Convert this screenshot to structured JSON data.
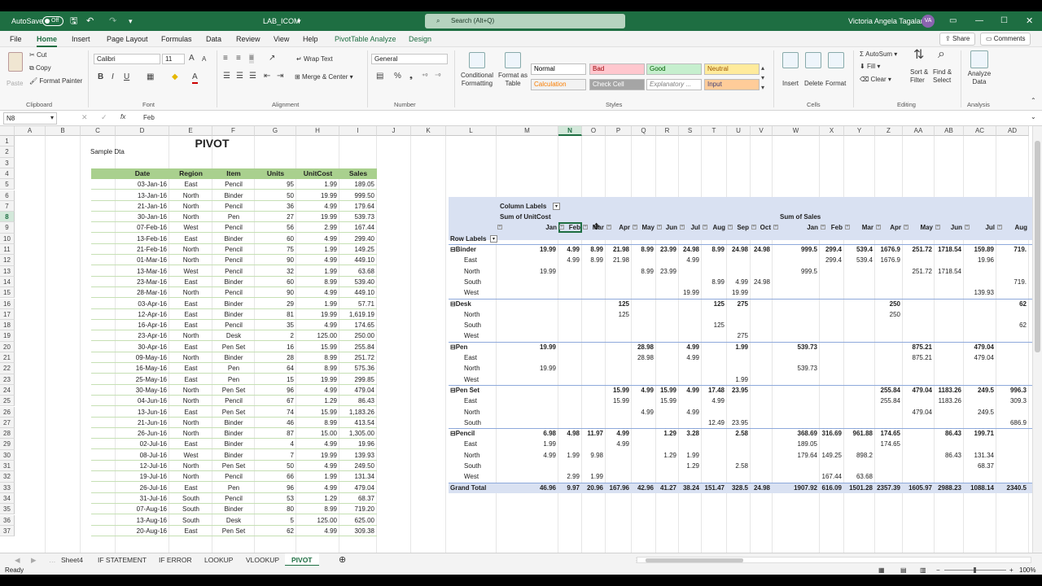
{
  "titlebar": {
    "autosave": "AutoSave",
    "toggle": "Off",
    "filename": "LAB_ICOM",
    "search": "Search (Alt+Q)",
    "user": "Victoria Angela Tagalan",
    "initials": "VA"
  },
  "menu": {
    "tabs": [
      "File",
      "Home",
      "Insert",
      "Page Layout",
      "Formulas",
      "Data",
      "Review",
      "View",
      "Help",
      "PivotTable Analyze",
      "Design"
    ],
    "share": "Share",
    "comments": "Comments"
  },
  "ribbon": {
    "paste": "Paste",
    "cut": "Cut",
    "copy": "Copy",
    "format_painter": "Format Painter",
    "clipboard": "Clipboard",
    "font_name": "Calibri",
    "font_size": "11",
    "font": "Font",
    "wrap_text": "Wrap Text",
    "merge": "Merge & Center",
    "alignment": "Alignment",
    "number_format": "General",
    "number": "Number",
    "cond_format": "Conditional Formatting",
    "format_table": "Format as Table",
    "styles": [
      {
        "label": "Normal",
        "bg": "#ffffff",
        "fg": "#000000"
      },
      {
        "label": "Bad",
        "bg": "#ffc7ce",
        "fg": "#9c0006"
      },
      {
        "label": "Good",
        "bg": "#c6efce",
        "fg": "#006100"
      },
      {
        "label": "Neutral",
        "bg": "#ffeb9c",
        "fg": "#9c5700"
      },
      {
        "label": "Calculation",
        "bg": "#f2f2f2",
        "fg": "#fa7d00"
      },
      {
        "label": "Check Cell",
        "bg": "#a5a5a5",
        "fg": "#ffffff"
      },
      {
        "label": "Explanatory ...",
        "bg": "#ffffff",
        "fg": "#7f7f7f"
      },
      {
        "label": "Input",
        "bg": "#ffcc99",
        "fg": "#3f3f76"
      }
    ],
    "styles_label": "Styles",
    "insert": "Insert",
    "delete": "Delete",
    "format": "Format",
    "cells": "Cells",
    "autosum": "AutoSum",
    "fill": "Fill",
    "clear": "Clear",
    "sort_filter": "Sort & Filter",
    "find_select": "Find & Select",
    "editing": "Editing",
    "analyze_data": "Analyze Data",
    "analysis": "Analysis"
  },
  "formula_bar": {
    "name_box": "N8",
    "fx": "fx",
    "content": "Feb"
  },
  "columns": [
    "A",
    "B",
    "C",
    "D",
    "E",
    "F",
    "G",
    "H",
    "I",
    "J",
    "K",
    "L",
    "M",
    "N",
    "O",
    "P",
    "Q",
    "R",
    "S",
    "T",
    "U",
    "V",
    "W",
    "X",
    "Y",
    "Z",
    "AA",
    "AB",
    "AC",
    "AD"
  ],
  "rows": [
    "1",
    "2",
    "3",
    "4",
    "5",
    "6",
    "7",
    "8",
    "9",
    "10",
    "11",
    "12",
    "13",
    "14",
    "15",
    "16",
    "17",
    "18",
    "19",
    "20",
    "21",
    "22",
    "23",
    "24",
    "25",
    "26",
    "27",
    "28",
    "29",
    "30",
    "31",
    "32",
    "33",
    "34",
    "35",
    "36",
    "37"
  ],
  "sheet": {
    "title": "PIVOT",
    "subtitle": "Sample Dta",
    "headers": [
      "Date",
      "Region",
      "Item",
      "Units",
      "UnitCost",
      "Sales"
    ],
    "data": [
      [
        "03-Jan-16",
        "East",
        "Pencil",
        "95",
        "1.99",
        "189.05"
      ],
      [
        "13-Jan-16",
        "North",
        "Binder",
        "50",
        "19.99",
        "999.50"
      ],
      [
        "21-Jan-16",
        "North",
        "Pencil",
        "36",
        "4.99",
        "179.64"
      ],
      [
        "30-Jan-16",
        "North",
        "Pen",
        "27",
        "19.99",
        "539.73"
      ],
      [
        "07-Feb-16",
        "West",
        "Pencil",
        "56",
        "2.99",
        "167.44"
      ],
      [
        "13-Feb-16",
        "East",
        "Binder",
        "60",
        "4.99",
        "299.40"
      ],
      [
        "21-Feb-16",
        "North",
        "Pencil",
        "75",
        "1.99",
        "149.25"
      ],
      [
        "01-Mar-16",
        "North",
        "Pencil",
        "90",
        "4.99",
        "449.10"
      ],
      [
        "13-Mar-16",
        "West",
        "Pencil",
        "32",
        "1.99",
        "63.68"
      ],
      [
        "23-Mar-16",
        "East",
        "Binder",
        "60",
        "8.99",
        "539.40"
      ],
      [
        "28-Mar-16",
        "North",
        "Pencil",
        "90",
        "4.99",
        "449.10"
      ],
      [
        "03-Apr-16",
        "East",
        "Binder",
        "29",
        "1.99",
        "57.71"
      ],
      [
        "12-Apr-16",
        "East",
        "Binder",
        "81",
        "19.99",
        "1,619.19"
      ],
      [
        "16-Apr-16",
        "East",
        "Pencil",
        "35",
        "4.99",
        "174.65"
      ],
      [
        "23-Apr-16",
        "North",
        "Desk",
        "2",
        "125.00",
        "250.00"
      ],
      [
        "30-Apr-16",
        "East",
        "Pen Set",
        "16",
        "15.99",
        "255.84"
      ],
      [
        "09-May-16",
        "North",
        "Binder",
        "28",
        "8.99",
        "251.72"
      ],
      [
        "16-May-16",
        "East",
        "Pen",
        "64",
        "8.99",
        "575.36"
      ],
      [
        "25-May-16",
        "East",
        "Pen",
        "15",
        "19.99",
        "299.85"
      ],
      [
        "30-May-16",
        "North",
        "Pen Set",
        "96",
        "4.99",
        "479.04"
      ],
      [
        "04-Jun-16",
        "North",
        "Pencil",
        "67",
        "1.29",
        "86.43"
      ],
      [
        "13-Jun-16",
        "East",
        "Pen Set",
        "74",
        "15.99",
        "1,183.26"
      ],
      [
        "21-Jun-16",
        "North",
        "Binder",
        "46",
        "8.99",
        "413.54"
      ],
      [
        "26-Jun-16",
        "North",
        "Binder",
        "87",
        "15.00",
        "1,305.00"
      ],
      [
        "02-Jul-16",
        "East",
        "Binder",
        "4",
        "4.99",
        "19.96"
      ],
      [
        "08-Jul-16",
        "West",
        "Binder",
        "7",
        "19.99",
        "139.93"
      ],
      [
        "12-Jul-16",
        "North",
        "Pen Set",
        "50",
        "4.99",
        "249.50"
      ],
      [
        "19-Jul-16",
        "North",
        "Pencil",
        "66",
        "1.99",
        "131.34"
      ],
      [
        "26-Jul-16",
        "East",
        "Pen",
        "96",
        "4.99",
        "479.04"
      ],
      [
        "31-Jul-16",
        "South",
        "Pencil",
        "53",
        "1.29",
        "68.37"
      ],
      [
        "07-Aug-16",
        "South",
        "Binder",
        "80",
        "8.99",
        "719.20"
      ],
      [
        "13-Aug-16",
        "South",
        "Desk",
        "5",
        "125.00",
        "625.00"
      ],
      [
        "20-Aug-16",
        "East",
        "Pen Set",
        "62",
        "4.99",
        "309.38"
      ]
    ]
  },
  "pivot": {
    "column_labels": "Column Labels",
    "sum_unitcost": "Sum of UnitCost",
    "sum_sales": "Sum of Sales",
    "row_labels": "Row Labels",
    "months_cost": [
      "Jan",
      "Feb",
      "Mar",
      "Apr",
      "May",
      "Jun",
      "Jul",
      "Aug",
      "Sep",
      "Oct"
    ],
    "months_sales": [
      "Jan",
      "Feb",
      "Mar",
      "Apr",
      "May",
      "Jun",
      "Jul",
      "Aug"
    ],
    "rows": [
      {
        "label": "Binder",
        "bold": true,
        "v": [
          "19.99",
          "4.99",
          "8.99",
          "21.98",
          "8.99",
          "23.99",
          "24.98",
          "8.99",
          "24.98",
          "24.98",
          "999.5",
          "299.4",
          "539.4",
          "1676.9",
          "251.72",
          "1718.54",
          "159.89",
          "719."
        ]
      },
      {
        "label": "East",
        "v": [
          "",
          "4.99",
          "8.99",
          "21.98",
          "",
          "",
          "4.99",
          "",
          "",
          "",
          "",
          "299.4",
          "539.4",
          "1676.9",
          "",
          "",
          "19.96",
          ""
        ]
      },
      {
        "label": "North",
        "v": [
          "19.99",
          "",
          "",
          "",
          "8.99",
          "23.99",
          "",
          "",
          "",
          "",
          "999.5",
          "",
          "",
          "",
          "251.72",
          "1718.54",
          "",
          ""
        ]
      },
      {
        "label": "South",
        "v": [
          "",
          "",
          "",
          "",
          "",
          "",
          "",
          "8.99",
          "4.99",
          "24.98",
          "",
          "",
          "",
          "",
          "",
          "",
          "",
          "719."
        ]
      },
      {
        "label": "West",
        "v": [
          "",
          "",
          "",
          "",
          "",
          "",
          "19.99",
          "",
          "19.99",
          "",
          "",
          "",
          "",
          "",
          "",
          "",
          "139.93",
          ""
        ]
      },
      {
        "label": "Desk",
        "bold": true,
        "v": [
          "",
          "",
          "",
          "125",
          "",
          "",
          "",
          "125",
          "275",
          "",
          "",
          "",
          "",
          "250",
          "",
          "",
          "",
          "62"
        ]
      },
      {
        "label": "North",
        "v": [
          "",
          "",
          "",
          "125",
          "",
          "",
          "",
          "",
          "",
          "",
          "",
          "",
          "",
          "250",
          "",
          "",
          "",
          ""
        ]
      },
      {
        "label": "South",
        "v": [
          "",
          "",
          "",
          "",
          "",
          "",
          "",
          "125",
          "",
          "",
          "",
          "",
          "",
          "",
          "",
          "",
          "",
          "62"
        ]
      },
      {
        "label": "West",
        "v": [
          "",
          "",
          "",
          "",
          "",
          "",
          "",
          "",
          "275",
          "",
          "",
          "",
          "",
          "",
          "",
          "",
          "",
          ""
        ]
      },
      {
        "label": "Pen",
        "bold": true,
        "v": [
          "19.99",
          "",
          "",
          "",
          "28.98",
          "",
          "4.99",
          "",
          "1.99",
          "",
          "539.73",
          "",
          "",
          "",
          "875.21",
          "",
          "479.04",
          ""
        ]
      },
      {
        "label": "East",
        "v": [
          "",
          "",
          "",
          "",
          "28.98",
          "",
          "4.99",
          "",
          "",
          "",
          "",
          "",
          "",
          "",
          "875.21",
          "",
          "479.04",
          ""
        ]
      },
      {
        "label": "North",
        "v": [
          "19.99",
          "",
          "",
          "",
          "",
          "",
          "",
          "",
          "",
          "",
          "539.73",
          "",
          "",
          "",
          "",
          "",
          "",
          ""
        ]
      },
      {
        "label": "West",
        "v": [
          "",
          "",
          "",
          "",
          "",
          "",
          "",
          "",
          "1.99",
          "",
          "",
          "",
          "",
          "",
          "",
          "",
          "",
          ""
        ]
      },
      {
        "label": "Pen Set",
        "bold": true,
        "v": [
          "",
          "",
          "",
          "15.99",
          "4.99",
          "15.99",
          "4.99",
          "17.48",
          "23.95",
          "",
          "",
          "",
          "",
          "255.84",
          "479.04",
          "1183.26",
          "249.5",
          "996.3"
        ]
      },
      {
        "label": "East",
        "v": [
          "",
          "",
          "",
          "15.99",
          "",
          "15.99",
          "",
          "4.99",
          "",
          "",
          "",
          "",
          "",
          "255.84",
          "",
          "1183.26",
          "",
          "309.3"
        ]
      },
      {
        "label": "North",
        "v": [
          "",
          "",
          "",
          "",
          "4.99",
          "",
          "4.99",
          "",
          "",
          "",
          "",
          "",
          "",
          "",
          "479.04",
          "",
          "249.5",
          ""
        ]
      },
      {
        "label": "South",
        "v": [
          "",
          "",
          "",
          "",
          "",
          "",
          "",
          "12.49",
          "23.95",
          "",
          "",
          "",
          "",
          "",
          "",
          "",
          "",
          "686.9"
        ]
      },
      {
        "label": "Pencil",
        "bold": true,
        "v": [
          "6.98",
          "4.98",
          "11.97",
          "4.99",
          "",
          "1.29",
          "3.28",
          "",
          "2.58",
          "",
          "368.69",
          "316.69",
          "961.88",
          "174.65",
          "",
          "86.43",
          "199.71",
          ""
        ]
      },
      {
        "label": "East",
        "v": [
          "1.99",
          "",
          "",
          "4.99",
          "",
          "",
          "",
          "",
          "",
          "",
          "189.05",
          "",
          "",
          "174.65",
          "",
          "",
          "",
          ""
        ]
      },
      {
        "label": "North",
        "v": [
          "4.99",
          "1.99",
          "9.98",
          "",
          "",
          "1.29",
          "1.99",
          "",
          "",
          "",
          "179.64",
          "149.25",
          "898.2",
          "",
          "",
          "86.43",
          "131.34",
          ""
        ]
      },
      {
        "label": "South",
        "v": [
          "",
          "",
          "",
          "",
          "",
          "",
          "1.29",
          "",
          "2.58",
          "",
          "",
          "",
          "",
          "",
          "",
          "",
          "68.37",
          ""
        ]
      },
      {
        "label": "West",
        "v": [
          "",
          "2.99",
          "1.99",
          "",
          "",
          "",
          "",
          "",
          "",
          "",
          "",
          "167.44",
          "63.68",
          "",
          "",
          "",
          "",
          ""
        ]
      },
      {
        "label": "Grand Total",
        "bold": true,
        "total": true,
        "v": [
          "46.96",
          "9.97",
          "20.96",
          "167.96",
          "42.96",
          "41.27",
          "38.24",
          "151.47",
          "328.5",
          "24.98",
          "1907.92",
          "616.09",
          "1501.28",
          "2357.39",
          "1605.97",
          "2988.23",
          "1088.14",
          "2340.5"
        ]
      }
    ]
  },
  "sheet_tabs": [
    "Sheet4",
    "IF STATEMENT",
    "IF ERROR",
    "LOOKUP",
    "VLOOKUP",
    "PIVOT"
  ],
  "active_tab": "PIVOT",
  "status": {
    "ready": "Ready",
    "zoom": "100%"
  }
}
